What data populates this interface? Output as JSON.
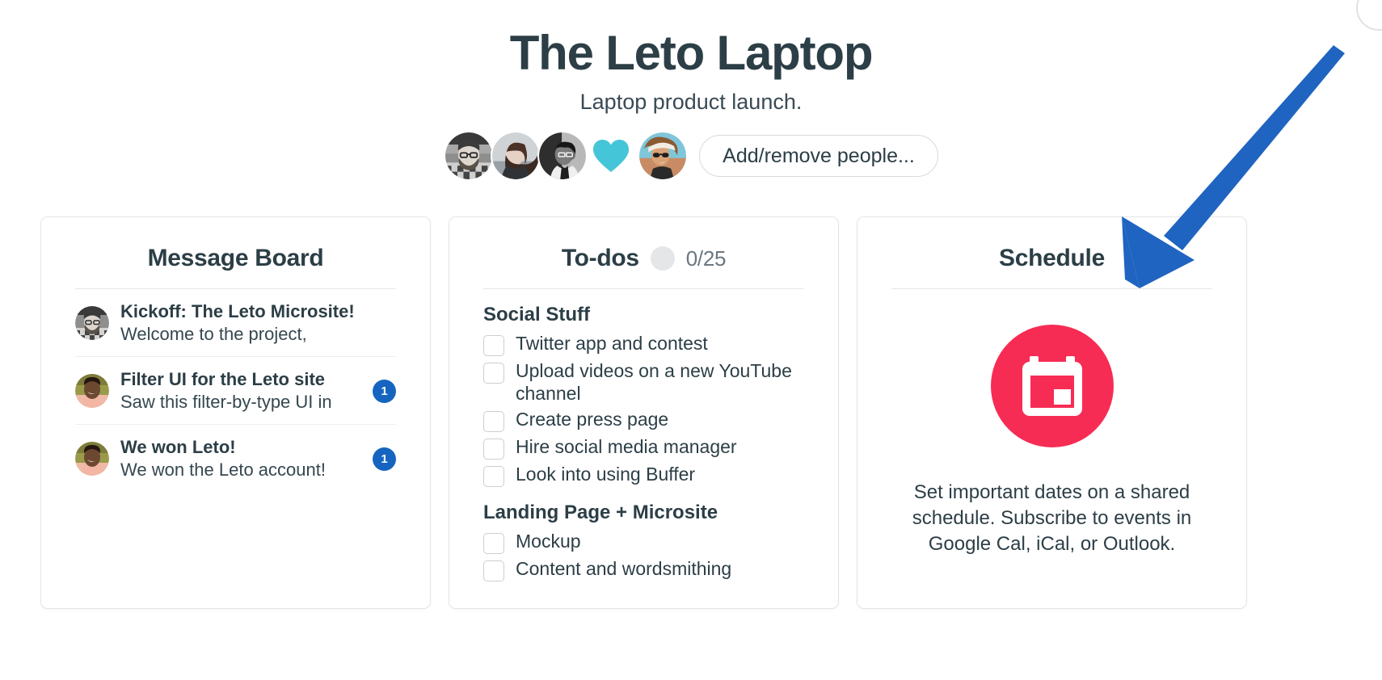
{
  "header": {
    "title": "The Leto Laptop",
    "subtitle": "Laptop product launch.",
    "add_people_label": "Add/remove people...",
    "people": [
      {
        "name": "person-1-avatar"
      },
      {
        "name": "person-2-avatar"
      },
      {
        "name": "person-3-avatar"
      },
      {
        "name": "heart-icon"
      },
      {
        "name": "person-4-avatar"
      }
    ]
  },
  "message_board": {
    "title": "Message Board",
    "messages": [
      {
        "subject": "Kickoff: The Leto Microsite!",
        "excerpt": "Welcome to the project,",
        "badge": ""
      },
      {
        "subject": "Filter UI for the Leto site",
        "excerpt": "Saw this filter-by-type UI in",
        "badge": "1"
      },
      {
        "subject": "We won Leto!",
        "excerpt": "We won the Leto account!",
        "badge": "1"
      }
    ]
  },
  "todos": {
    "title": "To-dos",
    "count": "0/25",
    "groups": [
      {
        "name": "Social Stuff",
        "items": [
          "Twitter app and contest",
          "Upload videos on a new YouTube channel",
          "Create press page",
          "Hire social media manager",
          "Look into using Buffer"
        ]
      },
      {
        "name": "Landing Page + Microsite",
        "items": [
          "Mockup",
          "Content and wordsmithing"
        ]
      }
    ]
  },
  "schedule": {
    "title": "Schedule",
    "icon": "calendar-icon",
    "description": "Set important dates on a shared schedule. Subscribe to events in Google Cal, iCal, or Outlook."
  },
  "annotation": {
    "type": "arrow",
    "color": "#1f64c0",
    "points_to": "schedule-card"
  },
  "colors": {
    "text_dark": "#2c3e46",
    "badge_blue": "#1565c0",
    "calendar_red": "#f72c54",
    "heart_teal": "#45c5d8",
    "card_border": "#e2e5e7"
  }
}
